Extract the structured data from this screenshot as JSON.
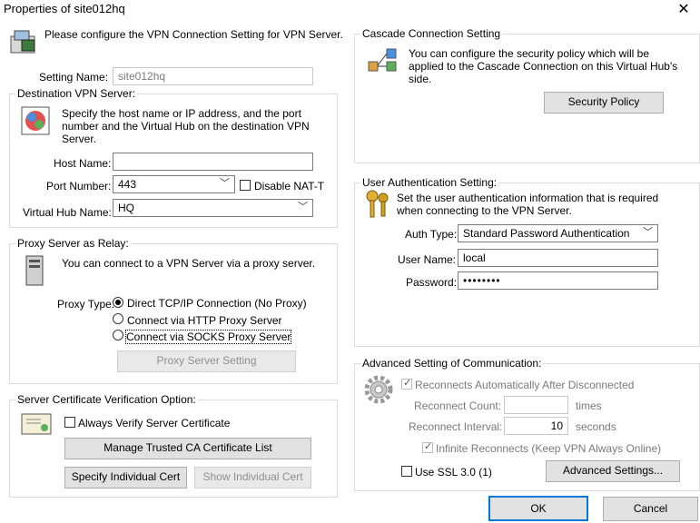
{
  "window": {
    "title": "Properties of site012hq",
    "close_glyph": "✕"
  },
  "intro": {
    "text": "Please configure the VPN Connection Setting for VPN Server."
  },
  "setting_name": {
    "label": "Setting Name:",
    "value": "site012hq"
  },
  "destination": {
    "legend": "Destination VPN Server:",
    "desc": "Specify the host name or IP address, and the port number and the Virtual Hub on the destination VPN Server.",
    "host_label": "Host Name:",
    "host_value": "",
    "port_label": "Port Number:",
    "port_value": "443",
    "nat_t_label": "Disable NAT-T",
    "nat_t_checked": false,
    "hub_label": "Virtual Hub Name:",
    "hub_value": "HQ"
  },
  "proxy": {
    "legend": "Proxy Server as Relay:",
    "desc": "You can connect to a VPN Server via a proxy server.",
    "type_label": "Proxy Type:",
    "options": [
      {
        "label": "Direct TCP/IP Connection (No Proxy)",
        "selected": true
      },
      {
        "label": "Connect via HTTP Proxy Server",
        "selected": false
      },
      {
        "label": "Connect via SOCKS Proxy Server",
        "selected": false
      }
    ],
    "setting_button": "Proxy Server Setting"
  },
  "cert": {
    "legend": "Server Certificate Verification Option:",
    "always_verify_label": "Always Verify Server Certificate",
    "always_verify_checked": false,
    "manage_ca_button": "Manage Trusted CA Certificate List",
    "specify_cert_button": "Specify Individual Cert",
    "show_cert_button": "Show Individual Cert"
  },
  "cascade": {
    "legend": "Cascade Connection Setting",
    "desc": "You can configure the security policy which will be applied to the Cascade Connection on this Virtual Hub's side.",
    "policy_button": "Security Policy"
  },
  "auth": {
    "legend": "User Authentication Setting:",
    "desc": "Set the user authentication information that is required when connecting to the VPN Server.",
    "type_label": "Auth Type:",
    "type_value": "Standard Password Authentication",
    "user_label": "User Name:",
    "user_value": "local",
    "password_label": "Password:",
    "password_value": "••••••••"
  },
  "advanced": {
    "legend": "Advanced Setting of Communication:",
    "reconnect_label": "Reconnects Automatically After Disconnected",
    "reconnect_count_label": "Reconnect Count:",
    "reconnect_count_value": "",
    "reconnect_count_unit": "times",
    "reconnect_interval_label": "Reconnect Interval:",
    "reconnect_interval_value": "10",
    "reconnect_interval_unit": "seconds",
    "infinite_label": "Infinite Reconnects (Keep VPN Always Online)",
    "ssl_label": "Use SSL 3.0 (1)",
    "ssl_checked": false,
    "advanced_button": "Advanced Settings..."
  },
  "footer": {
    "ok_button": "OK",
    "cancel_button": "Cancel"
  },
  "colors": {
    "accent": "#0078d7",
    "border": "#dcdcdc"
  }
}
